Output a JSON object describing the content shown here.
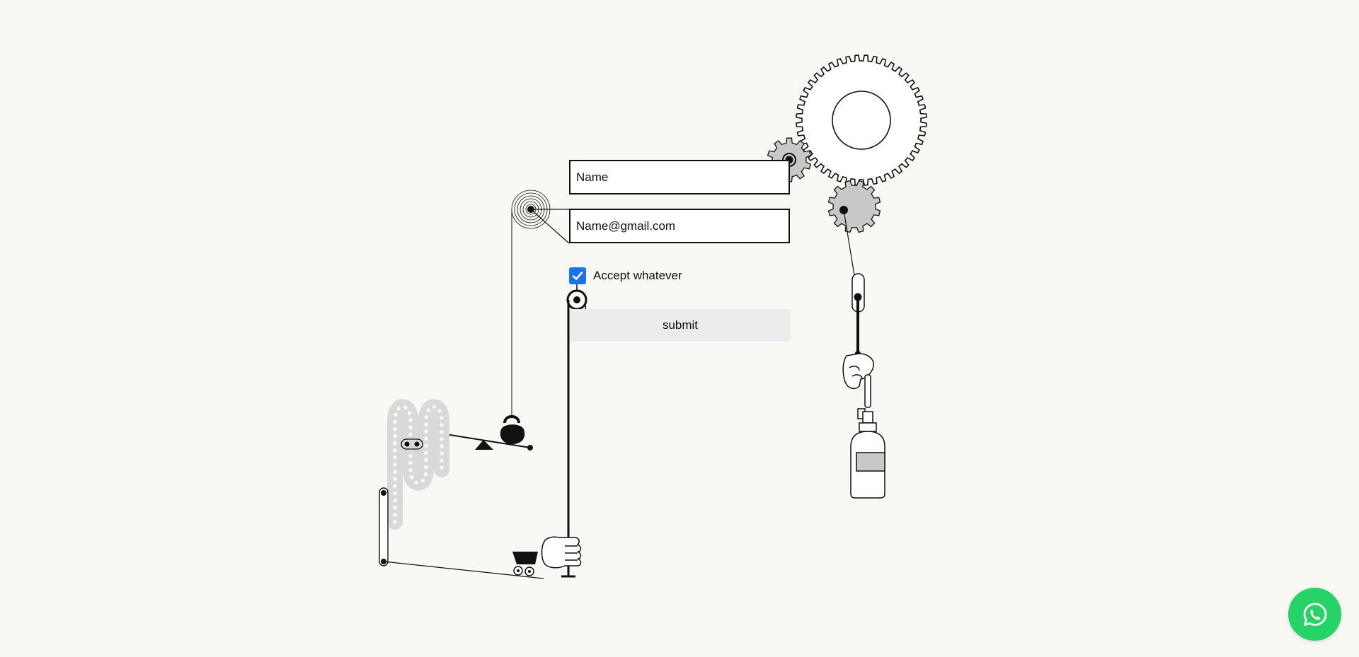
{
  "form": {
    "name_placeholder": "Name",
    "email_placeholder": "Name@gmail.com",
    "accept_label": "Accept whatever",
    "accept_checked": true,
    "submit_label": "submit"
  },
  "floating_action": {
    "icon": "whatsapp-icon"
  },
  "colors": {
    "background": "#f9f8f5",
    "checkbox_accent": "#1a73e8",
    "submit_bg": "#ececec",
    "whatsapp_green": "#25d366",
    "gear_fill": "#c8c8c8",
    "ink": "#111111"
  }
}
